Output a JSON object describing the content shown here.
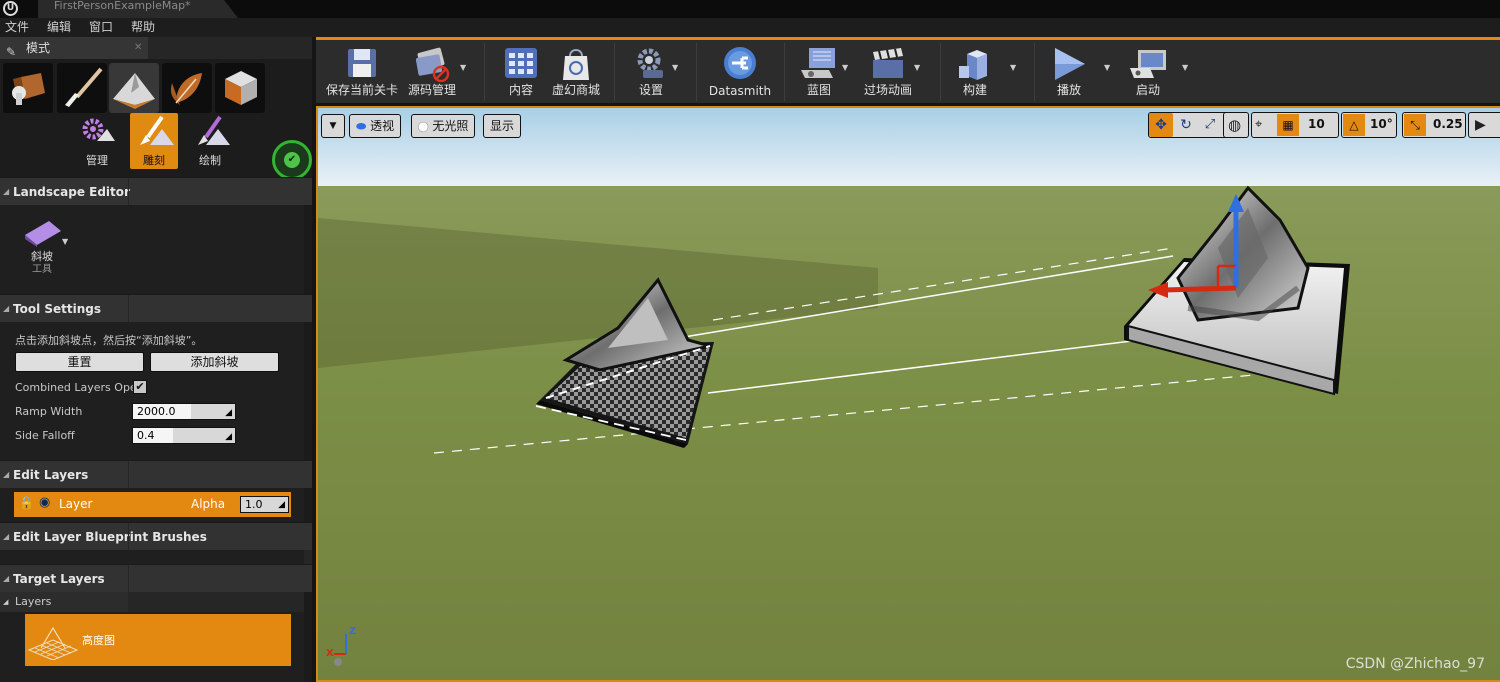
{
  "window": {
    "tab_title": "FirstPersonExampleMap*"
  },
  "menu": [
    "文件",
    "编辑",
    "窗口",
    "帮助"
  ],
  "modes_panel": {
    "tab_label": "模式",
    "subtools": [
      {
        "label": "管理",
        "active": false
      },
      {
        "label": "雕刻",
        "active": true
      },
      {
        "label": "绘制",
        "active": false
      }
    ]
  },
  "landscape_editor": {
    "header": "Landscape Editor",
    "tool_label": "斜坡",
    "tool_sublabel": "工具"
  },
  "tool_settings": {
    "header": "Tool Settings",
    "hint": "点击添加斜坡点，然后按“添加斜坡”。",
    "reset_button": "重置",
    "add_ramp_button": "添加斜坡",
    "combined_layers_label": "Combined Layers Oper",
    "combined_layers_checked": true,
    "ramp_width_label": "Ramp Width",
    "ramp_width_value": "2000.0",
    "side_falloff_label": "Side Falloff",
    "side_falloff_value": "0.4"
  },
  "edit_layers": {
    "header": "Edit Layers",
    "layer_name": "Layer",
    "alpha_label": "Alpha",
    "alpha_value": "1.0"
  },
  "blueprint_brushes": {
    "header": "Edit Layer Blueprint Brushes"
  },
  "target_layers": {
    "header": "Target Layers",
    "sub_header": "Layers",
    "heightmap_label": "高度图"
  },
  "toolbar": {
    "save_label": "保存当前关卡",
    "source_control_label": "源码管理",
    "content_label": "内容",
    "marketplace_label": "虚幻商城",
    "settings_label": "设置",
    "datasmith_label": "Datasmith",
    "blueprints_label": "蓝图",
    "cinematics_label": "过场动画",
    "build_label": "构建",
    "play_label": "播放",
    "launch_label": "启动"
  },
  "viewport": {
    "perspective_label": "透视",
    "lighting_label": "无光照",
    "show_label": "显示",
    "grid_snap_value": "10",
    "rotation_snap_value": "10°",
    "scale_snap_value": "0.25",
    "axis_x": "X",
    "axis_z": "Z"
  },
  "watermark": "CSDN @Zhichao_97",
  "colors": {
    "accent_orange": "#e38811",
    "gizmo_blue": "#2f6fe0",
    "gizmo_red": "#d42a12",
    "selection_green": "#33b532"
  }
}
